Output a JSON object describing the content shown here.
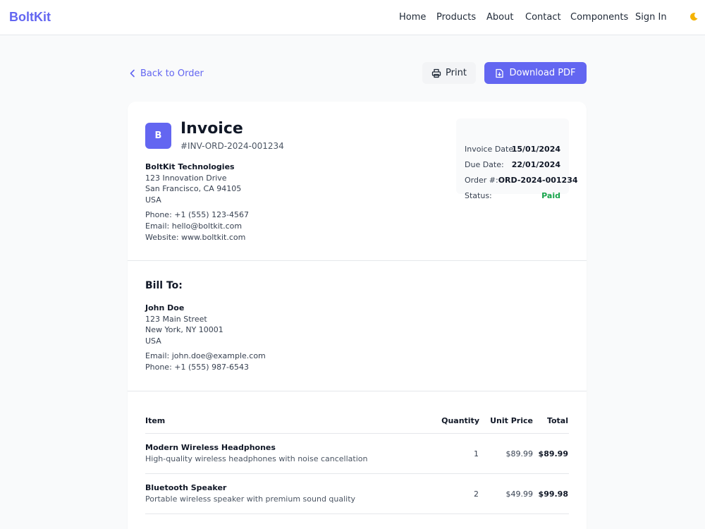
{
  "nav": {
    "brand": "BoltKit",
    "links": [
      "Home",
      "Products",
      "About",
      "Contact",
      "Components",
      "Sign In"
    ],
    "theme_icon": "moon-icon"
  },
  "actions": {
    "back_label": "Back to Order",
    "print_label": "Print",
    "pdf_label": "Download PDF"
  },
  "invoice": {
    "logo_letter": "B",
    "title": "Invoice",
    "number": "#INV-ORD-2024-001234",
    "company": {
      "name": "BoltKit Technologies",
      "address1": "123 Innovation Drive",
      "address2": "San Francisco, CA 94105",
      "country": "USA",
      "phone": "Phone: +1 (555) 123-4567",
      "email": "Email: hello@boltkit.com",
      "website": "Website: www.boltkit.com"
    },
    "meta": {
      "date_label": "Invoice Date:",
      "date_value": "15/01/2024",
      "due_label": "Due Date:",
      "due_value": "22/01/2024",
      "order_label": "Order #:",
      "order_value": "ORD-2024-001234",
      "status_label": "Status:",
      "status_value": "Paid"
    },
    "bill_to": {
      "title": "Bill To:",
      "name": "John Doe",
      "address1": "123 Main Street",
      "address2": "New York, NY 10001",
      "country": "USA",
      "email": "Email: john.doe@example.com",
      "phone": "Phone: +1 (555) 987-6543"
    },
    "table": {
      "headers": {
        "item": "Item",
        "quantity": "Quantity",
        "unit_price": "Unit Price",
        "total": "Total"
      },
      "rows": [
        {
          "name": "Modern Wireless Headphones",
          "description": "High-quality wireless headphones with noise cancellation",
          "quantity": "1",
          "unit_price": "$89.99",
          "total": "$89.99"
        },
        {
          "name": "Bluetooth Speaker",
          "description": "Portable wireless speaker with premium sound quality",
          "quantity": "2",
          "unit_price": "$49.99",
          "total": "$99.98"
        }
      ]
    }
  },
  "colors": {
    "accent": "#6366f1",
    "paid": "#16a34a",
    "background": "#f9fafb"
  }
}
